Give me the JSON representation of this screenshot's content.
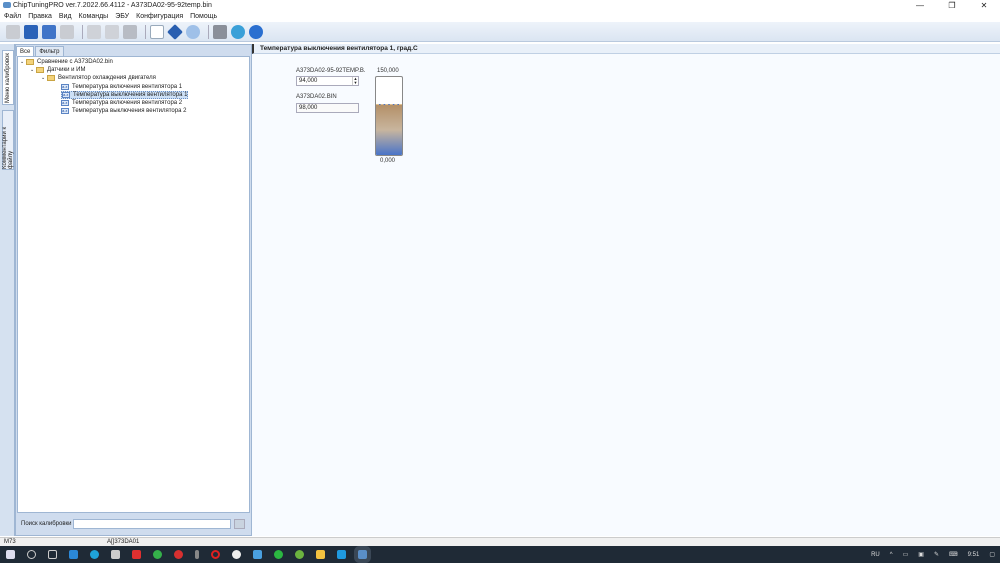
{
  "window": {
    "title": "ChipTuningPRO ver.7.2022.66.4112 - A373DA02-95-92temp.bin",
    "minimize": "—",
    "restore": "❐",
    "close": "✕"
  },
  "menu": [
    "Файл",
    "Правка",
    "Вид",
    "Команды",
    "ЭБУ",
    "Конфигурация",
    "Помощь"
  ],
  "toolbar": {
    "icons": [
      "open-icon",
      "save-icon",
      "save-as-icon",
      "print-icon",
      "copy-icon",
      "paste-icon",
      "undo-icon",
      "compare-icon",
      "ecu-info-icon",
      "search-icon",
      "tools-icon",
      "update-icon",
      "help-icon"
    ]
  },
  "vertical_tabs": [
    "Меню калибровок",
    "Комментарии к файлу"
  ],
  "left_panel": {
    "tabs": [
      "Все",
      "Фильтр"
    ],
    "tree": [
      {
        "label": "Сравнение с A373DA02.bin",
        "level": 0,
        "type": "folder"
      },
      {
        "label": "Датчики и ИМ",
        "level": 1,
        "type": "folder"
      },
      {
        "label": "Вентилятор охлаждения двигателя",
        "level": 2,
        "type": "folder"
      },
      {
        "label": "Температура включения вентилятора 1",
        "level": 3,
        "type": "leaf"
      },
      {
        "label": "Температура выключения вентилятора 1",
        "level": 3,
        "type": "leaf",
        "selected": true
      },
      {
        "label": "Температура включения вентилятора 2",
        "level": 3,
        "type": "leaf"
      },
      {
        "label": "Температура выключения вентилятора 2",
        "level": 3,
        "type": "leaf"
      }
    ],
    "search_label": "Поиск калибровки",
    "search_value": ""
  },
  "editor": {
    "title": "Температура выключения вентилятора 1, град.С",
    "file1_label": "A373DA02-95-92TEMP.B.",
    "file1_value": "94,000",
    "file2_label": "A373DA02.BIN",
    "file2_value": "98,000",
    "gauge_max_label": "150,000",
    "gauge_min_label": "0,000",
    "gauge_min": 0,
    "gauge_max": 150,
    "gauge_value": 98
  },
  "statusbar": {
    "left": "M73",
    "middle": "A[]373DA01"
  },
  "taskbar": {
    "lang": "RU",
    "time": "9:51"
  }
}
